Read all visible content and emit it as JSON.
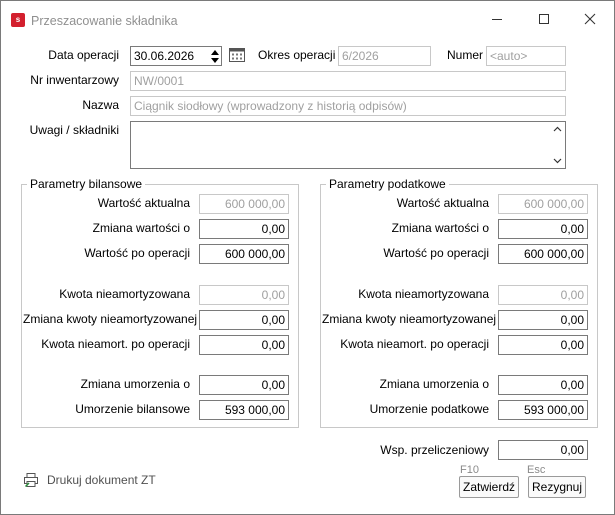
{
  "window": {
    "title": "Przeszacowanie składnika",
    "app_icon_letter": "s"
  },
  "header": {
    "data_operacji_label": "Data operacji",
    "data_operacji_value": "30.06.2026",
    "okres_operacji_label": "Okres operacji",
    "okres_operacji_value": "6/2026",
    "numer_label": "Numer",
    "numer_value": "<auto>",
    "nr_inwentarzowy_label": "Nr inwentarzowy",
    "nr_inwentarzowy_value": "NW/0001",
    "nazwa_label": "Nazwa",
    "nazwa_value": "Ciągnik siodłowy (wprowadzony z historią odpisów)",
    "uwagi_label": "Uwagi / składniki",
    "uwagi_value": ""
  },
  "bilansowe": {
    "title": "Parametry bilansowe",
    "wartosc_aktualna_label": "Wartość aktualna",
    "wartosc_aktualna": "600 000,00",
    "zmiana_wartosci_label": "Zmiana wartości o",
    "zmiana_wartosci": "0,00",
    "wartosc_po_label": "Wartość po operacji",
    "wartosc_po": "600 000,00",
    "kwota_nieam_label": "Kwota nieamortyzowana",
    "kwota_nieam": "0,00",
    "zmiana_kwoty_label": "Zmiana kwoty nieamortyzowanej",
    "zmiana_kwoty": "0,00",
    "kwota_po_label": "Kwota nieamort. po operacji",
    "kwota_po": "0,00",
    "zmiana_umorzenia_label": "Zmiana umorzenia o",
    "zmiana_umorzenia": "0,00",
    "umorzenie_label": "Umorzenie bilansowe",
    "umorzenie": "593 000,00"
  },
  "podatkowe": {
    "title": "Parametry podatkowe",
    "wartosc_aktualna_label": "Wartość aktualna",
    "wartosc_aktualna": "600 000,00",
    "zmiana_wartosci_label": "Zmiana wartości o",
    "zmiana_wartosci": "0,00",
    "wartosc_po_label": "Wartość po operacji",
    "wartosc_po": "600 000,00",
    "kwota_nieam_label": "Kwota nieamortyzowana",
    "kwota_nieam": "0,00",
    "zmiana_kwoty_label": "Zmiana kwoty nieamortyzowanej",
    "zmiana_kwoty": "0,00",
    "kwota_po_label": "Kwota nieamort. po operacji",
    "kwota_po": "0,00",
    "zmiana_umorzenia_label": "Zmiana umorzenia o",
    "zmiana_umorzenia": "0,00",
    "umorzenie_label": "Umorzenie podatkowe",
    "umorzenie": "593 000,00"
  },
  "footer": {
    "wsp_label": "Wsp. przeliczeniowy",
    "wsp_value": "0,00",
    "print_label": "Drukuj dokument ZT",
    "confirm_hint": "F10",
    "confirm_label": "Zatwierdź",
    "cancel_hint": "Esc",
    "cancel_label": "Rezygnuj"
  },
  "colors": {
    "app_icon": "#d3202e",
    "readonly_text": "#a0a0a0",
    "border": "#7a7a7a"
  }
}
